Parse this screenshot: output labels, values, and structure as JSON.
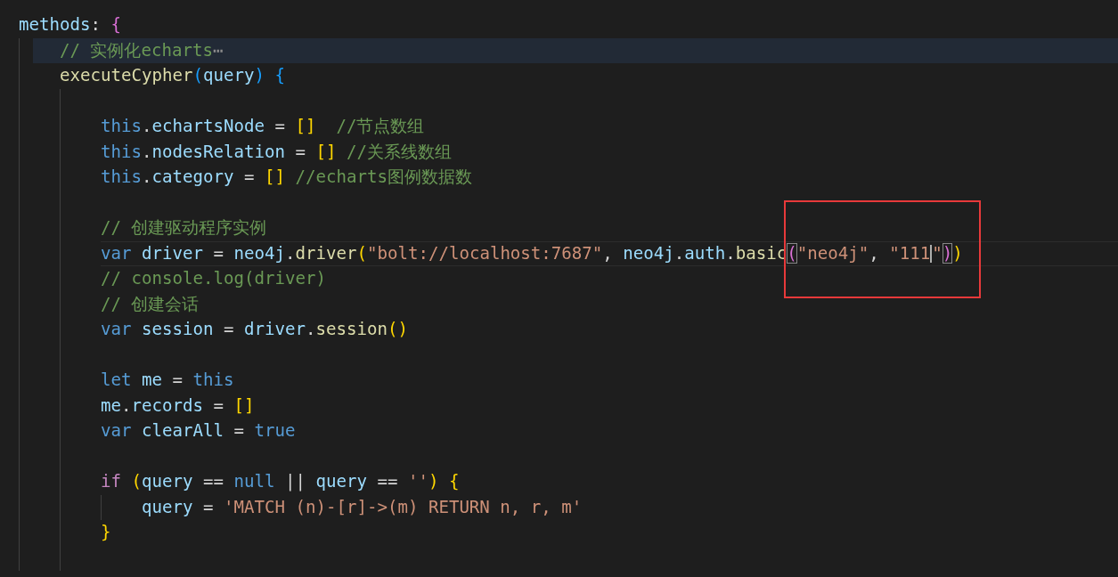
{
  "editor": {
    "lines": [
      {
        "tokens": [
          {
            "kind": "var",
            "text": "methods"
          },
          {
            "kind": "op",
            "text": ": "
          },
          {
            "kind": "b2",
            "text": "{"
          }
        ],
        "children": [
          {
            "highlighted": true,
            "tokens": [
              {
                "kind": "cmt",
                "text": "// 实例化echarts"
              },
              {
                "kind": "fold",
                "text": "⋯"
              }
            ]
          },
          {
            "tokens": [
              {
                "kind": "fn",
                "text": "executeCypher"
              },
              {
                "kind": "b3",
                "text": "("
              },
              {
                "kind": "var",
                "text": "query"
              },
              {
                "kind": "b3",
                "text": ") "
              },
              {
                "kind": "b3",
                "text": "{"
              }
            ],
            "children": [
              {
                "kind": "blank"
              },
              {
                "tokens": [
                  {
                    "kind": "kw",
                    "text": "this"
                  },
                  {
                    "kind": "op",
                    "text": "."
                  },
                  {
                    "kind": "var",
                    "text": "echartsNode"
                  },
                  {
                    "kind": "op",
                    "text": " = "
                  },
                  {
                    "kind": "b1",
                    "text": "[]  "
                  },
                  {
                    "kind": "cmt",
                    "text": "//节点数组"
                  }
                ]
              },
              {
                "tokens": [
                  {
                    "kind": "kw",
                    "text": "this"
                  },
                  {
                    "kind": "op",
                    "text": "."
                  },
                  {
                    "kind": "var",
                    "text": "nodesRelation"
                  },
                  {
                    "kind": "op",
                    "text": " = "
                  },
                  {
                    "kind": "b1",
                    "text": "[] "
                  },
                  {
                    "kind": "cmt",
                    "text": "//关系线数组"
                  }
                ]
              },
              {
                "tokens": [
                  {
                    "kind": "kw",
                    "text": "this"
                  },
                  {
                    "kind": "op",
                    "text": "."
                  },
                  {
                    "kind": "var",
                    "text": "category"
                  },
                  {
                    "kind": "op",
                    "text": " = "
                  },
                  {
                    "kind": "b1",
                    "text": "[] "
                  },
                  {
                    "kind": "cmt",
                    "text": "//echarts图例数据数"
                  }
                ]
              },
              {
                "kind": "blank"
              },
              {
                "tokens": [
                  {
                    "kind": "cmt",
                    "text": "// 创建驱动程序实例"
                  }
                ]
              },
              {
                "current": true,
                "tokens": [
                  {
                    "kind": "kw",
                    "text": "var "
                  },
                  {
                    "kind": "var",
                    "text": "driver"
                  },
                  {
                    "kind": "op",
                    "text": " = "
                  },
                  {
                    "kind": "var",
                    "text": "neo4j"
                  },
                  {
                    "kind": "op",
                    "text": "."
                  },
                  {
                    "kind": "fn",
                    "text": "driver"
                  },
                  {
                    "kind": "b1",
                    "text": "("
                  },
                  {
                    "kind": "str",
                    "text": "\"bolt://localhost:7687\""
                  },
                  {
                    "kind": "op",
                    "text": ", "
                  },
                  {
                    "kind": "var",
                    "text": "neo4j"
                  },
                  {
                    "kind": "op",
                    "text": "."
                  },
                  {
                    "kind": "var",
                    "text": "auth"
                  },
                  {
                    "kind": "op",
                    "text": "."
                  },
                  {
                    "kind": "fn",
                    "text": "basic"
                  },
                  {
                    "kind": "b2",
                    "text": "(",
                    "matched": true
                  },
                  {
                    "kind": "str",
                    "text": "\"neo4j\""
                  },
                  {
                    "kind": "op",
                    "text": ", "
                  },
                  {
                    "kind": "str",
                    "text": "\"111"
                  },
                  {
                    "kind": "cursor"
                  },
                  {
                    "kind": "str",
                    "text": "\""
                  },
                  {
                    "kind": "b2",
                    "text": ")",
                    "matched": true
                  },
                  {
                    "kind": "b1",
                    "text": ")"
                  }
                ]
              },
              {
                "tokens": [
                  {
                    "kind": "cmt",
                    "text": "// console.log(driver)"
                  }
                ]
              },
              {
                "tokens": [
                  {
                    "kind": "cmt",
                    "text": "// 创建会话"
                  }
                ]
              },
              {
                "tokens": [
                  {
                    "kind": "kw",
                    "text": "var "
                  },
                  {
                    "kind": "var",
                    "text": "session"
                  },
                  {
                    "kind": "op",
                    "text": " = "
                  },
                  {
                    "kind": "var",
                    "text": "driver"
                  },
                  {
                    "kind": "op",
                    "text": "."
                  },
                  {
                    "kind": "fn",
                    "text": "session"
                  },
                  {
                    "kind": "b1",
                    "text": "()"
                  }
                ]
              },
              {
                "kind": "blank"
              },
              {
                "tokens": [
                  {
                    "kind": "kw",
                    "text": "let "
                  },
                  {
                    "kind": "var",
                    "text": "me"
                  },
                  {
                    "kind": "op",
                    "text": " = "
                  },
                  {
                    "kind": "kw",
                    "text": "this"
                  }
                ]
              },
              {
                "tokens": [
                  {
                    "kind": "var",
                    "text": "me"
                  },
                  {
                    "kind": "op",
                    "text": "."
                  },
                  {
                    "kind": "var",
                    "text": "records"
                  },
                  {
                    "kind": "op",
                    "text": " = "
                  },
                  {
                    "kind": "b1",
                    "text": "[]"
                  }
                ]
              },
              {
                "tokens": [
                  {
                    "kind": "kw",
                    "text": "var "
                  },
                  {
                    "kind": "var",
                    "text": "clearAll"
                  },
                  {
                    "kind": "op",
                    "text": " = "
                  },
                  {
                    "kind": "kw",
                    "text": "true"
                  }
                ]
              },
              {
                "kind": "blank"
              },
              {
                "tokens": [
                  {
                    "kind": "ctrl",
                    "text": "if "
                  },
                  {
                    "kind": "b1",
                    "text": "("
                  },
                  {
                    "kind": "var",
                    "text": "query"
                  },
                  {
                    "kind": "op",
                    "text": " == "
                  },
                  {
                    "kind": "kw",
                    "text": "null"
                  },
                  {
                    "kind": "op",
                    "text": " || "
                  },
                  {
                    "kind": "var",
                    "text": "query"
                  },
                  {
                    "kind": "op",
                    "text": " == "
                  },
                  {
                    "kind": "str",
                    "text": "''"
                  },
                  {
                    "kind": "b1",
                    "text": ") "
                  },
                  {
                    "kind": "b1",
                    "text": "{"
                  }
                ],
                "children": [
                  {
                    "tokens": [
                      {
                        "kind": "var",
                        "text": "query"
                      },
                      {
                        "kind": "op",
                        "text": " = "
                      },
                      {
                        "kind": "str",
                        "text": "'MATCH (n)-[r]->(m) RETURN n, r, m'"
                      }
                    ]
                  }
                ]
              },
              {
                "tokens": [
                  {
                    "kind": "b1",
                    "text": "}"
                  }
                ]
              },
              {
                "kind": "blank"
              }
            ]
          }
        ]
      }
    ]
  },
  "annotation_box": true
}
